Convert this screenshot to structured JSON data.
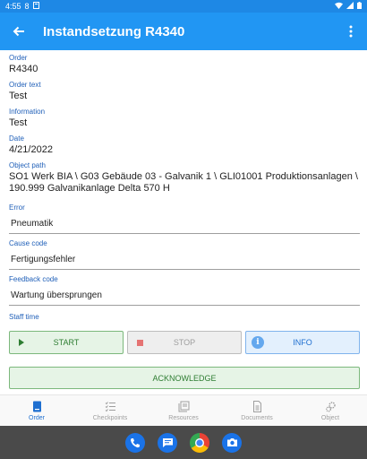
{
  "status_bar": {
    "time": "4:55",
    "sim_glyph": "8"
  },
  "app_bar": {
    "title": "Instandsetzung R4340"
  },
  "fields": [
    {
      "label": "Order",
      "value": "R4340"
    },
    {
      "label": "Order text",
      "value": "Test"
    },
    {
      "label": "Information",
      "value": "Test"
    },
    {
      "label": "Date",
      "value": "4/21/2022"
    },
    {
      "label": "Object path",
      "value": "SO1 Werk BIA \\ G03 Gebäude 03 - Galvanik 1 \\ GLI01001 Produktionsanlagen \\ 190.999 Galvanikanlage Delta 570 H"
    }
  ],
  "inputs": [
    {
      "label": "Error",
      "value": "Pneumatik"
    },
    {
      "label": "Cause code",
      "value": "Fertigungsfehler"
    },
    {
      "label": "Feedback code",
      "value": "Wartung übersprungen"
    }
  ],
  "staff_time": {
    "label": "Staff time",
    "start": "START",
    "stop": "STOP",
    "info": "INFO",
    "info_glyph": "i"
  },
  "acknowledge": "ACKNOWLEDGE",
  "bottom_nav": [
    {
      "label": "Order",
      "icon": "order-icon",
      "active": true
    },
    {
      "label": "Checkpoints",
      "icon": "checklist-icon",
      "active": false
    },
    {
      "label": "Resources",
      "icon": "resources-icon",
      "active": false
    },
    {
      "label": "Documents",
      "icon": "document-icon",
      "active": false
    },
    {
      "label": "Object",
      "icon": "gears-icon",
      "active": false
    }
  ],
  "colors": {
    "primary": "#2196f3",
    "accent_green": "#2e7d32",
    "label_blue": "#1f5fb8"
  }
}
